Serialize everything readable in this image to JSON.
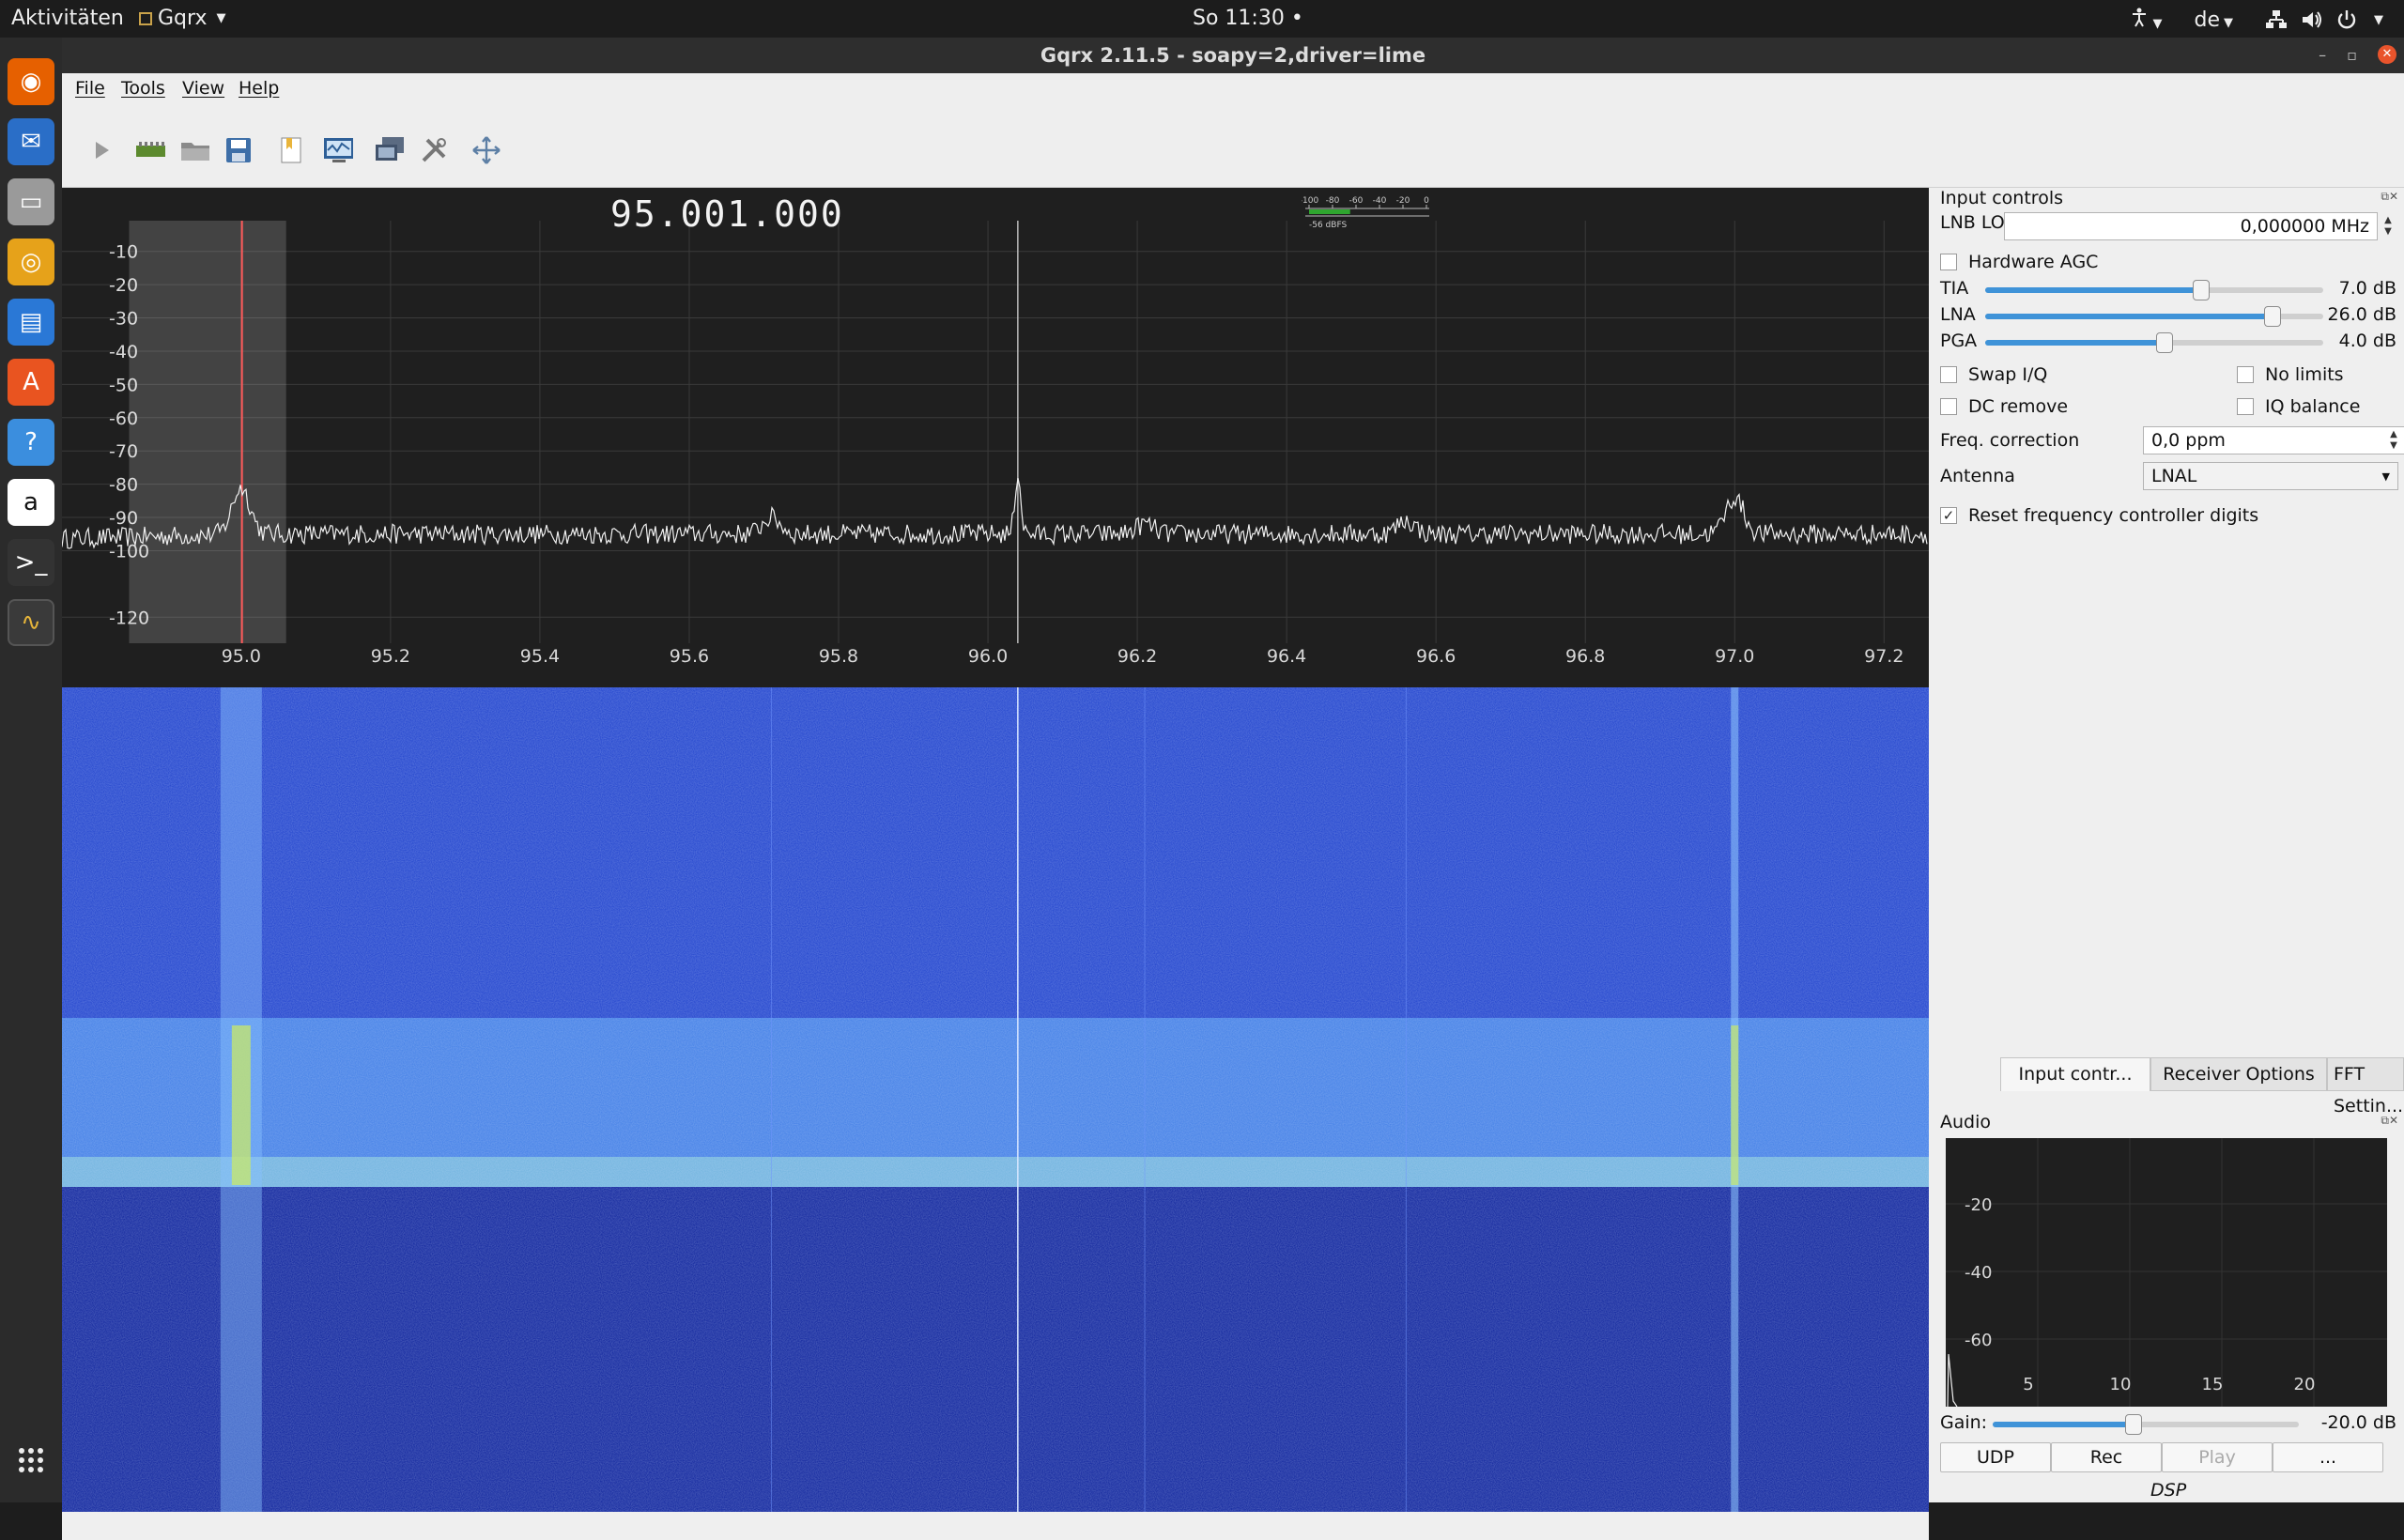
{
  "topbar": {
    "activities": "Aktivitäten",
    "app_name": "Gqrx",
    "clock": "So 11:30",
    "clock_dot": "•",
    "keyboard_layout": "de",
    "icons": [
      "accessibility-icon",
      "network-icon",
      "volume-icon",
      "power-icon"
    ]
  },
  "dock": {
    "items": [
      {
        "name": "firefox-icon",
        "color": "#e66000",
        "glyph": "◉"
      },
      {
        "name": "thunderbird-icon",
        "color": "#2a6ec7",
        "glyph": "✉"
      },
      {
        "name": "files-icon",
        "color": "#9a9a9a",
        "glyph": "▭"
      },
      {
        "name": "rhythmbox-icon",
        "color": "#e6a21a",
        "glyph": "◎"
      },
      {
        "name": "libreoffice-writer-icon",
        "color": "#2a78d6",
        "glyph": "▤"
      },
      {
        "name": "software-center-icon",
        "color": "#e95420",
        "glyph": "A"
      },
      {
        "name": "help-icon",
        "color": "#3b8ede",
        "glyph": "?"
      },
      {
        "name": "amazon-icon",
        "color": "#ffffff",
        "glyph": "a"
      },
      {
        "name": "terminal-icon",
        "color": "#333333",
        "glyph": ">_"
      },
      {
        "name": "gqrx-icon",
        "color": "#3a3a3a",
        "glyph": "∿"
      }
    ],
    "apps_grid": "apps-grid-icon"
  },
  "window": {
    "title": "Gqrx 2.11.5 - soapy=2,driver=lime",
    "minimize": "–",
    "maximize": "▫",
    "close": "✕"
  },
  "menu": [
    "File",
    "Tools",
    "View",
    "Help"
  ],
  "toolbar": [
    "play-icon",
    "device-config-icon",
    "open-icon",
    "save-icon",
    "bookmarks-icon",
    "remote-control-icon",
    "screen-capture-icon",
    "settings-tools-icon",
    "fullscreen-icon"
  ],
  "plot": {
    "frequency_display": "95.001.000",
    "meter_ticks": [
      "-100",
      "-80",
      "-60",
      "-40",
      "-20",
      "0"
    ],
    "meter_reading": "-56 dBFS",
    "meter_level_fraction": 0.35
  },
  "chart_data": {
    "type": "line",
    "title": "",
    "xlabel": "",
    "ylabel": "",
    "x_ticks": [
      "95.0",
      "95.2",
      "95.4",
      "95.6",
      "95.8",
      "96.0",
      "96.2",
      "96.4",
      "96.6",
      "96.8",
      "97.0",
      "97.2"
    ],
    "x_tick_values": [
      95.0,
      95.2,
      95.4,
      95.6,
      95.8,
      96.0,
      96.2,
      96.4,
      96.6,
      96.8,
      97.0,
      97.2
    ],
    "y_ticks": [
      "-10",
      "-20",
      "-30",
      "-40",
      "-50",
      "-60",
      "-70",
      "-80",
      "-90",
      "-100",
      "-120"
    ],
    "y_tick_values": [
      -10,
      -20,
      -30,
      -40,
      -50,
      -60,
      -70,
      -80,
      -90,
      -100,
      -120
    ],
    "xlim": [
      94.76,
      97.26
    ],
    "ylim": [
      -125,
      -5
    ],
    "noise_floor_db": -95,
    "peaks": [
      {
        "freq": 95.0,
        "db": -81
      },
      {
        "freq": 95.71,
        "db": -90
      },
      {
        "freq": 96.04,
        "db": -77
      },
      {
        "freq": 96.21,
        "db": -92
      },
      {
        "freq": 96.56,
        "db": -91
      },
      {
        "freq": 97.0,
        "db": -84
      }
    ],
    "filter_band": [
      94.87,
      95.03
    ],
    "demod_freq": 95.001,
    "center_marker": 96.04,
    "grid": true
  },
  "input_controls": {
    "title": "Input controls",
    "lnb_lo_label": "LNB LO",
    "lnb_lo_value": "0,000000 MHz",
    "hardware_agc": "Hardware AGC",
    "gains": [
      {
        "label": "TIA",
        "value": "7.0 dB",
        "fraction": 0.64
      },
      {
        "label": "LNA",
        "value": "26.0 dB",
        "fraction": 0.85
      },
      {
        "label": "PGA",
        "value": "4.0 dB",
        "fraction": 0.53
      }
    ],
    "swap_iq": "Swap I/Q",
    "no_limits": "No limits",
    "dc_remove": "DC remove",
    "iq_balance": "IQ balance",
    "freq_corr_label": "Freq. correction",
    "freq_corr_value": "0,0 ppm",
    "antenna_label": "Antenna",
    "antenna_value": "LNAL",
    "reset_digits": "Reset frequency controller digits",
    "reset_digits_check": "✓"
  },
  "tabs": [
    "Input contr...",
    "Receiver Options",
    "FFT Settin..."
  ],
  "audio": {
    "title": "Audio",
    "y_ticks": [
      "-20",
      "-40",
      "-60"
    ],
    "x_ticks": [
      "5",
      "10",
      "15",
      "20"
    ],
    "gain_label": "Gain:",
    "gain_value": "-20.0 dB",
    "gain_fraction": 0.46,
    "buttons": [
      "UDP",
      "Rec",
      "Play",
      "..."
    ],
    "dsp_label": "DSP"
  }
}
